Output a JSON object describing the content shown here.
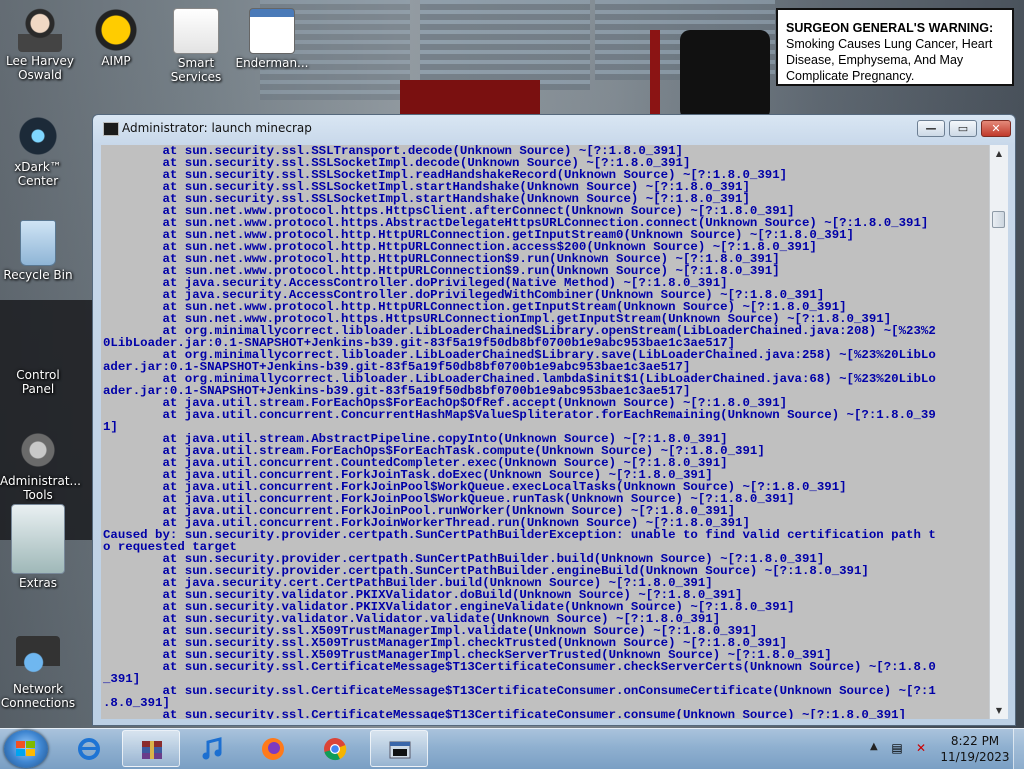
{
  "desktop": {
    "icons": [
      {
        "label": "Lee Harvey Oswald",
        "icon": "character-icon"
      },
      {
        "label": "AIMP",
        "icon": "aimp-icon"
      },
      {
        "label": "Smart Services",
        "icon": "services-icon"
      },
      {
        "label": "Enderman...",
        "icon": "app-window-icon"
      },
      {
        "label": "xDark™ Center",
        "icon": "xdark-icon"
      },
      {
        "label": "Recycle Bin",
        "icon": "recycle-bin-icon"
      },
      {
        "label": "Control Panel",
        "icon": "control-panel-icon"
      },
      {
        "label": "Administrat... Tools",
        "icon": "admin-tools-icon"
      },
      {
        "label": "Extras",
        "icon": "extras-icon"
      },
      {
        "label": "Network Connections",
        "icon": "network-icon"
      }
    ],
    "warning": {
      "heading": "SURGEON GENERAL'S WARNING:",
      "body": "Smoking Causes Lung Cancer, Heart Disease, Emphysema, And May Complicate Pregnancy."
    }
  },
  "window": {
    "title": "Administrator:  launch minecrap",
    "buttons": {
      "minimize": "—",
      "maximize": "▭",
      "close": "✕"
    }
  },
  "console_lines": [
    "        at sun.security.ssl.SSLTransport.decode(Unknown Source) ~[?:1.8.0_391]",
    "        at sun.security.ssl.SSLSocketImpl.decode(Unknown Source) ~[?:1.8.0_391]",
    "        at sun.security.ssl.SSLSocketImpl.readHandshakeRecord(Unknown Source) ~[?:1.8.0_391]",
    "        at sun.security.ssl.SSLSocketImpl.startHandshake(Unknown Source) ~[?:1.8.0_391]",
    "        at sun.security.ssl.SSLSocketImpl.startHandshake(Unknown Source) ~[?:1.8.0_391]",
    "        at sun.net.www.protocol.https.HttpsClient.afterConnect(Unknown Source) ~[?:1.8.0_391]",
    "        at sun.net.www.protocol.https.AbstractDelegateHttpsURLConnection.connect(Unknown Source) ~[?:1.8.0_391]",
    "        at sun.net.www.protocol.http.HttpURLConnection.getInputStream0(Unknown Source) ~[?:1.8.0_391]",
    "        at sun.net.www.protocol.http.HttpURLConnection.access$200(Unknown Source) ~[?:1.8.0_391]",
    "        at sun.net.www.protocol.http.HttpURLConnection$9.run(Unknown Source) ~[?:1.8.0_391]",
    "        at sun.net.www.protocol.http.HttpURLConnection$9.run(Unknown Source) ~[?:1.8.0_391]",
    "        at java.security.AccessController.doPrivileged(Native Method) ~[?:1.8.0_391]",
    "        at java.security.AccessController.doPrivilegedWithCombiner(Unknown Source) ~[?:1.8.0_391]",
    "        at sun.net.www.protocol.http.HttpURLConnection.getInputStream(Unknown Source) ~[?:1.8.0_391]",
    "        at sun.net.www.protocol.https.HttpsURLConnectionImpl.getInputStream(Unknown Source) ~[?:1.8.0_391]",
    "        at org.minimallycorrect.libloader.LibLoaderChained$Library.openStream(LibLoaderChained.java:208) ~[%23%2",
    "0LibLoader.jar:0.1-SNAPSHOT+Jenkins-b39.git-83f5a19f50db8bf0700b1e9abc953bae1c3ae517]",
    "        at org.minimallycorrect.libloader.LibLoaderChained$Library.save(LibLoaderChained.java:258) ~[%23%20LibLo",
    "ader.jar:0.1-SNAPSHOT+Jenkins-b39.git-83f5a19f50db8bf0700b1e9abc953bae1c3ae517]",
    "        at org.minimallycorrect.libloader.LibLoaderChained.lambda$init$1(LibLoaderChained.java:68) ~[%23%20LibLo",
    "ader.jar:0.1-SNAPSHOT+Jenkins-b39.git-83f5a19f50db8bf0700b1e9abc953bae1c3ae517]",
    "        at java.util.stream.ForEachOps$ForEachOp$OfRef.accept(Unknown Source) ~[?:1.8.0_391]",
    "        at java.util.concurrent.ConcurrentHashMap$ValueSpliterator.forEachRemaining(Unknown Source) ~[?:1.8.0_39",
    "1]",
    "        at java.util.stream.AbstractPipeline.copyInto(Unknown Source) ~[?:1.8.0_391]",
    "        at java.util.stream.ForEachOps$ForEachTask.compute(Unknown Source) ~[?:1.8.0_391]",
    "        at java.util.concurrent.CountedCompleter.exec(Unknown Source) ~[?:1.8.0_391]",
    "        at java.util.concurrent.ForkJoinTask.doExec(Unknown Source) ~[?:1.8.0_391]",
    "        at java.util.concurrent.ForkJoinPool$WorkQueue.execLocalTasks(Unknown Source) ~[?:1.8.0_391]",
    "        at java.util.concurrent.ForkJoinPool$WorkQueue.runTask(Unknown Source) ~[?:1.8.0_391]",
    "        at java.util.concurrent.ForkJoinPool.runWorker(Unknown Source) ~[?:1.8.0_391]",
    "        at java.util.concurrent.ForkJoinWorkerThread.run(Unknown Source) ~[?:1.8.0_391]",
    "Caused by: sun.security.provider.certpath.SunCertPathBuilderException: unable to find valid certification path t",
    "o requested target",
    "        at sun.security.provider.certpath.SunCertPathBuilder.build(Unknown Source) ~[?:1.8.0_391]",
    "        at sun.security.provider.certpath.SunCertPathBuilder.engineBuild(Unknown Source) ~[?:1.8.0_391]",
    "        at java.security.cert.CertPathBuilder.build(Unknown Source) ~[?:1.8.0_391]",
    "        at sun.security.validator.PKIXValidator.doBuild(Unknown Source) ~[?:1.8.0_391]",
    "        at sun.security.validator.PKIXValidator.engineValidate(Unknown Source) ~[?:1.8.0_391]",
    "        at sun.security.validator.Validator.validate(Unknown Source) ~[?:1.8.0_391]",
    "        at sun.security.ssl.X509TrustManagerImpl.validate(Unknown Source) ~[?:1.8.0_391]",
    "        at sun.security.ssl.X509TrustManagerImpl.checkTrusted(Unknown Source) ~[?:1.8.0_391]",
    "        at sun.security.ssl.X509TrustManagerImpl.checkServerTrusted(Unknown Source) ~[?:1.8.0_391]",
    "        at sun.security.ssl.CertificateMessage$T13CertificateConsumer.checkServerCerts(Unknown Source) ~[?:1.8.0",
    "_391]",
    "        at sun.security.ssl.CertificateMessage$T13CertificateConsumer.onConsumeCertificate(Unknown Source) ~[?:1",
    ".8.0_391]",
    "        at sun.security.ssl.CertificateMessage$T13CertificateConsumer.consume(Unknown Source) ~[?:1.8.0_391]"
  ],
  "taskbar": {
    "apps": [
      {
        "icon": "internet-explorer-icon"
      },
      {
        "icon": "archive-icon"
      },
      {
        "icon": "music-player-icon"
      },
      {
        "icon": "firefox-icon"
      },
      {
        "icon": "chrome-icon"
      },
      {
        "icon": "console-icon"
      }
    ],
    "time": "8:22 PM",
    "date": "11/19/2023"
  },
  "colors": {
    "console_bg": "#c0c0c0",
    "console_text": "#0000a8",
    "taskbar": "#8fb0d0"
  }
}
